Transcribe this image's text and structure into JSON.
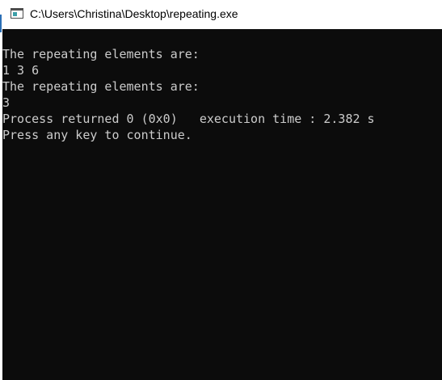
{
  "window": {
    "title": "C:\\Users\\Christina\\Desktop\\repeating.exe",
    "icon": "console-app-icon"
  },
  "console": {
    "background": "#0c0c0c",
    "foreground": "#cccccc",
    "lines": [
      "The repeating elements are:",
      "1 3 6",
      "The repeating elements are:",
      "3",
      "Process returned 0 (0x0)   execution time : 2.382 s",
      "Press any key to continue."
    ]
  }
}
